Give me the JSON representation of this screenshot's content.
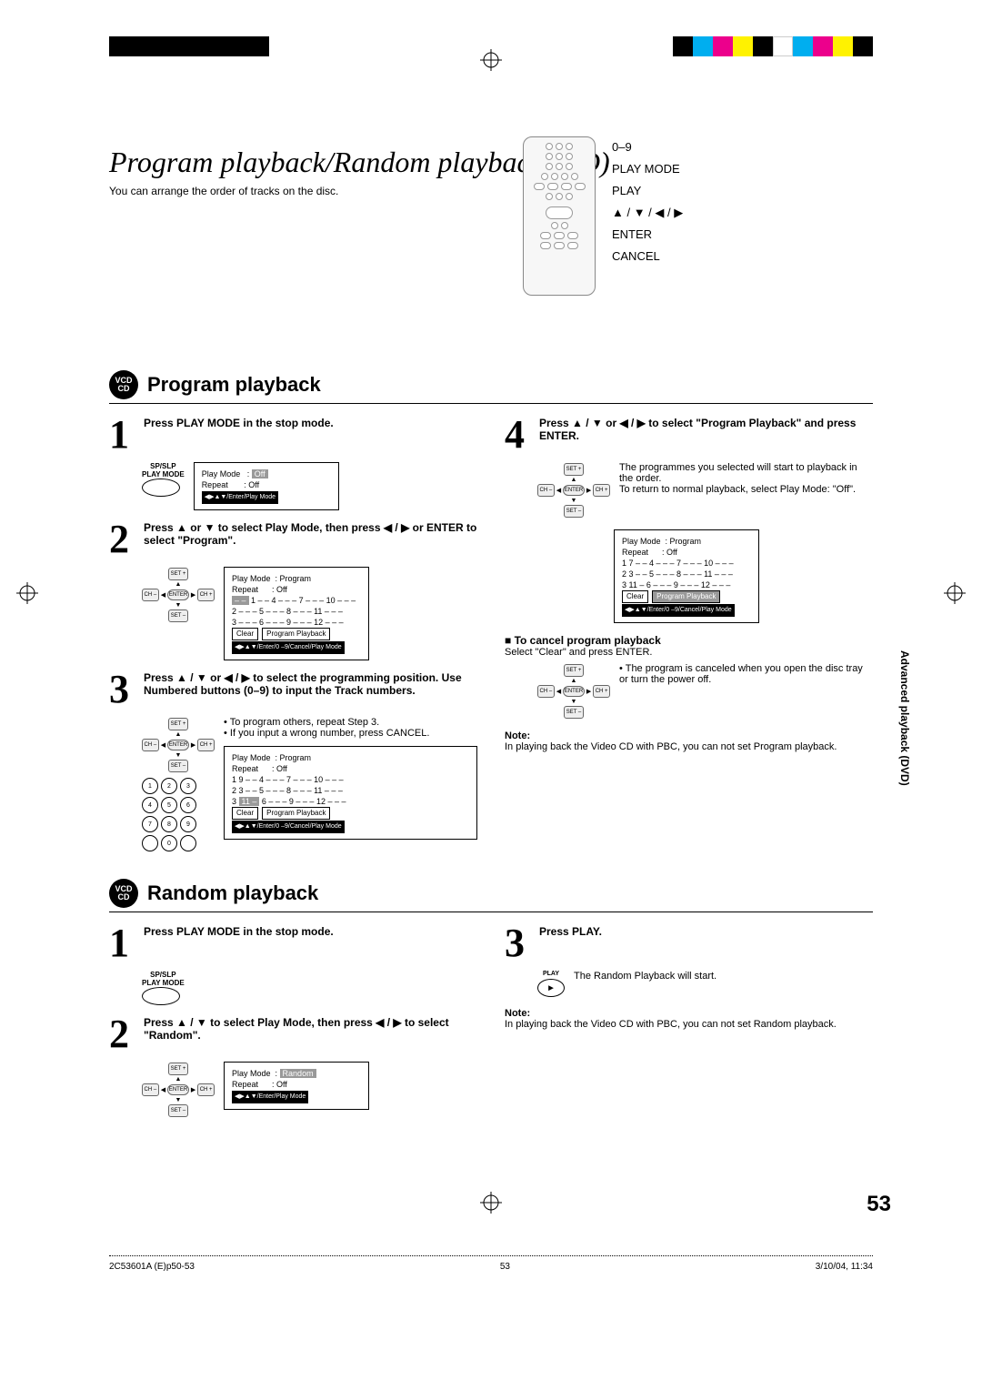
{
  "title": "Program playback/Random playback (CD)",
  "subtitle": "You can arrange the order of tracks on the disc.",
  "remote_labels": [
    "0–9",
    "PLAY MODE",
    "PLAY",
    "▲ / ▼ / ◀ / ▶",
    "ENTER",
    "CANCEL"
  ],
  "disc_badge": {
    "line1": "VCD",
    "line2": "CD"
  },
  "section_program": "Program playback",
  "section_random": "Random playback",
  "program": {
    "step1": "Press PLAY MODE in the stop mode.",
    "step1_btn1": "SP/SLP",
    "step1_btn2": "PLAY MODE",
    "osd1": {
      "l1": "Play Mode",
      "v1": "Off",
      "l2": "Repeat",
      "v2": "Off",
      "foot": "◀▶▲▼/Enter/Play Mode"
    },
    "step2": "Press ▲ or ▼ to select Play Mode, then press ◀ / ▶ or ENTER to select \"Program\".",
    "osd2": {
      "l1": "Play Mode",
      "v1": "Program",
      "l2": "Repeat",
      "v2": "Off",
      "rows": [
        "1 – –   4 – – –   7 – – –   10 – – –",
        "2 – – –   5 – – –   8 – – –   11 – – –",
        "3 – – –   6 – – –   9 – – –   12 – – –"
      ],
      "clear": "Clear",
      "pp": "Program Playback",
      "foot": "◀▶▲▼/Enter/0 –9/Cancel/Play Mode"
    },
    "step3": "Press ▲ / ▼ or ◀ / ▶ to select the programming position. Use Numbered buttons (0–9) to input the Track numbers.",
    "step3_bullets": [
      "To program others, repeat Step 3.",
      "If you input a wrong number, press CANCEL."
    ],
    "cancel_bold": "CANCEL.",
    "osd3": {
      "l1": "Play Mode",
      "v1": "Program",
      "l2": "Repeat",
      "v2": "Off",
      "rows": [
        "1  9 – –   4 – – –   7 – – –   10 – – –",
        "2  3 – –   5 – – –   8 – – –   11 – – –",
        "3 11 –    6 – – –   9 – – –   12 – – –"
      ],
      "clear": "Clear",
      "pp": "Program Playback",
      "foot": "◀▶▲▼/Enter/0 –9/Cancel/Play Mode"
    },
    "step4": "Press ▲ / ▼ or ◀ / ▶ to select \"Program Playback\" and press ENTER.",
    "step4_body": "The programmes you selected will start to playback in the order.\nTo return to normal playback, select Play Mode: \"Off\".",
    "osd4": {
      "l1": "Play Mode",
      "v1": "Program",
      "l2": "Repeat",
      "v2": "Off",
      "rows": [
        "1  7 – –   4 – – –   7 – – –   10 – – –",
        "2  3 – –   5 – – –   8 – – –   11 – – –",
        "3 11 –    6 – – –   9 – – –   12 – – –"
      ],
      "clear": "Clear",
      "pp": "Program Playback",
      "foot": "◀▶▲▼/Enter/0 –9/Cancel/Play Mode"
    },
    "cancel_heading": "■ To cancel program playback",
    "cancel_body": "Select \"Clear\" and press ENTER.",
    "cancel_bullet": "The program is canceled when you open the disc tray or turn the power off.",
    "note_label": "Note:",
    "note_body": "In playing back the Video CD with PBC, you can not set Program playback."
  },
  "random": {
    "step1": "Press PLAY MODE in the stop mode.",
    "step1_btn1": "SP/SLP",
    "step1_btn2": "PLAY MODE",
    "step2": "Press ▲ / ▼ to select Play Mode, then press ◀ / ▶ to select \"Random\".",
    "osd": {
      "l1": "Play Mode",
      "v1": "Random",
      "l2": "Repeat",
      "v2": "Off",
      "foot": "◀▶▲▼/Enter/Play Mode"
    },
    "step3": "Press PLAY.",
    "step3_body": "The Random Playback will start.",
    "play_label": "PLAY",
    "note_label": "Note:",
    "note_body": "In playing back the Video CD with PBC, you can not set Random playback."
  },
  "dpad": {
    "set_plus": "SET +",
    "set_minus": "SET –",
    "ch_minus": "CH –",
    "ch_plus": "CH +",
    "enter": "ENTER"
  },
  "numpad": [
    "1",
    "2",
    "3",
    "4",
    "5",
    "6",
    "7",
    "8",
    "9",
    "0"
  ],
  "side_text": "Advanced playback (DVD)",
  "page_number": "53",
  "footer": {
    "left": "2C53601A (E)p50-53",
    "center": "53",
    "right": "3/10/04, 11:34"
  }
}
